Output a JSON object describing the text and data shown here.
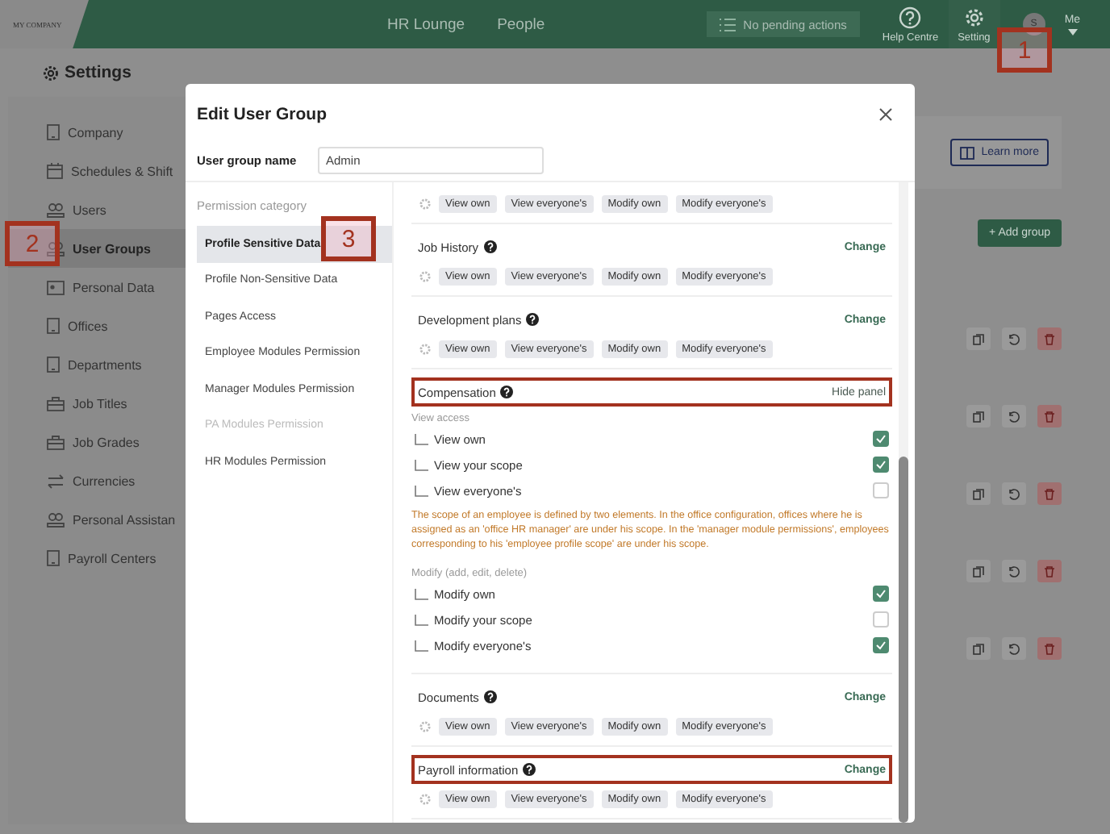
{
  "topbar": {
    "logo": "MY COMPANY",
    "nav": [
      {
        "label": "HR Lounge"
      },
      {
        "label": "People"
      }
    ],
    "pending": "No pending actions",
    "help": "Help Centre",
    "settings": "Setting",
    "avatar": "S",
    "me": "Me"
  },
  "page_title": "Settings",
  "sidebar": {
    "items": [
      {
        "label": "Company",
        "kind": "building",
        "selected": false
      },
      {
        "label": "Schedules & Shift",
        "kind": "calendar",
        "selected": false
      },
      {
        "label": "Users",
        "kind": "people",
        "selected": false
      },
      {
        "label": "User Groups",
        "kind": "people",
        "selected": true
      },
      {
        "label": "Personal Data",
        "kind": "card",
        "selected": false
      },
      {
        "label": "Offices",
        "kind": "building",
        "selected": false
      },
      {
        "label": "Departments",
        "kind": "building",
        "selected": false
      },
      {
        "label": "Job Titles",
        "kind": "briefcase",
        "selected": false
      },
      {
        "label": "Job Grades",
        "kind": "briefcase",
        "selected": false
      },
      {
        "label": "Currencies",
        "kind": "arrows",
        "selected": false
      },
      {
        "label": "Personal Assistan",
        "kind": "people",
        "selected": false
      },
      {
        "label": "Payroll Centers",
        "kind": "building",
        "selected": false
      }
    ]
  },
  "background": {
    "learn_more": "Learn more",
    "add_group": "+ Add group"
  },
  "modal": {
    "title": "Edit User Group",
    "name_label": "User group name",
    "name_value": "Admin",
    "category_heading": "Permission category",
    "categories": [
      {
        "label": "Profile Sensitive Data",
        "selected": true,
        "disabled": false
      },
      {
        "label": "Profile Non-Sensitive Data",
        "selected": false,
        "disabled": false
      },
      {
        "label": "Pages Access",
        "selected": false,
        "disabled": false
      },
      {
        "label": "Employee Modules Permission",
        "selected": false,
        "disabled": false
      },
      {
        "label": "Manager Modules Permission",
        "selected": false,
        "disabled": false
      },
      {
        "label": "PA Modules Permission",
        "selected": false,
        "disabled": true
      },
      {
        "label": "HR Modules Permission",
        "selected": false,
        "disabled": false
      }
    ],
    "sections": [
      {
        "chips": [
          "View own",
          "View everyone's",
          "Modify own",
          "Modify everyone's"
        ]
      },
      {
        "title": "Job History",
        "action": "Change",
        "highlighted": false,
        "expanded": false,
        "chips": [
          "View own",
          "View everyone's",
          "Modify own",
          "Modify everyone's"
        ]
      },
      {
        "title": "Development plans",
        "action": "Change",
        "highlighted": false,
        "expanded": false,
        "chips": [
          "View own",
          "View everyone's",
          "Modify own",
          "Modify everyone's"
        ]
      },
      {
        "title": "Compensation",
        "action": "Hide panel",
        "highlighted": true,
        "expanded": true,
        "view_heading": "View access",
        "view": [
          {
            "label": "View own",
            "checked": true
          },
          {
            "label": "View your scope",
            "checked": true
          },
          {
            "label": "View everyone's",
            "checked": false
          }
        ],
        "note": "The scope of an employee is defined by two elements. In the office configuration, offices where he is assigned as an 'office HR manager' are under his scope. In the 'manager module permissions', employees corresponding to his 'employee profile scope' are under his scope.",
        "modify_heading": "Modify (add, edit, delete)",
        "modify": [
          {
            "label": "Modify own",
            "checked": true
          },
          {
            "label": "Modify your scope",
            "checked": false
          },
          {
            "label": "Modify everyone's",
            "checked": true
          }
        ]
      },
      {
        "title": "Documents",
        "action": "Change",
        "highlighted": false,
        "expanded": false,
        "chips": [
          "View own",
          "View everyone's",
          "Modify own",
          "Modify everyone's"
        ]
      },
      {
        "title": "Payroll information",
        "action": "Change",
        "highlighted": true,
        "expanded": false,
        "chips": [
          "View own",
          "View everyone's",
          "Modify own",
          "Modify everyone's"
        ]
      }
    ]
  },
  "annotations": [
    {
      "label": "1"
    },
    {
      "label": "2"
    },
    {
      "label": "3"
    }
  ]
}
